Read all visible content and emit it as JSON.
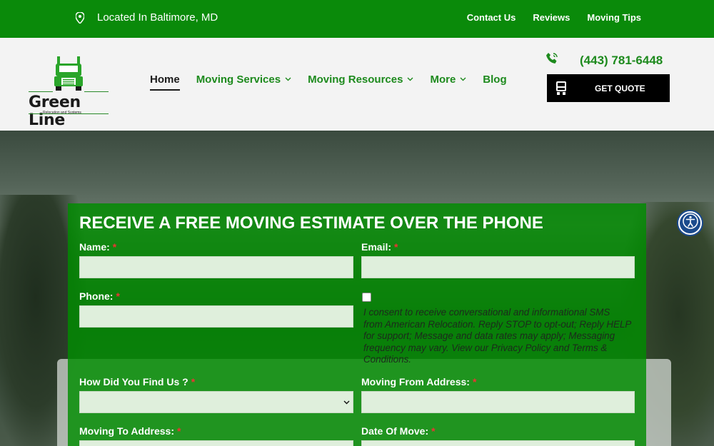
{
  "topbar": {
    "location": "Located In Baltimore, MD",
    "links": [
      "Contact Us",
      "Reviews",
      "Moving Tips"
    ]
  },
  "logo": {
    "name": "Green Line",
    "tagline": "Relocation and Systems"
  },
  "nav": {
    "items": [
      {
        "label": "Home",
        "active": true,
        "dropdown": false
      },
      {
        "label": "Moving Services",
        "active": false,
        "dropdown": true
      },
      {
        "label": "Moving Resources",
        "active": false,
        "dropdown": true
      },
      {
        "label": "More",
        "active": false,
        "dropdown": true
      },
      {
        "label": "Blog",
        "active": false,
        "dropdown": false
      }
    ]
  },
  "phone": "(443) 781-6448",
  "quote_button": "GET QUOTE",
  "form": {
    "title": "RECEIVE A FREE MOVING ESTIMATE OVER THE PHONE",
    "required_mark": "*",
    "name_label": "Name:",
    "email_label": "Email:",
    "phone_label": "Phone:",
    "consent_text": "I consent to receive conversational and informational SMS from American Relocation. Reply STOP to opt-out; Reply HELP for support; Message and data rates may apply; Messaging frequency may vary. View our Privacy Policy and Terms & Conditions.",
    "find_label": "How Did You Find Us ?",
    "from_label": "Moving From Address:",
    "to_label": "Moving To Address:",
    "date_label": "Date Of Move:"
  },
  "colors": {
    "brand_green": "#0a8a0a",
    "nav_green": "#1d8a1d",
    "form_green": "#008c00",
    "accessibility_blue": "#1b4a8c"
  },
  "icons": {
    "location": "map-pin-icon",
    "phone": "phone-icon",
    "quote": "truck-icon",
    "accessibility": "accessibility-icon"
  }
}
